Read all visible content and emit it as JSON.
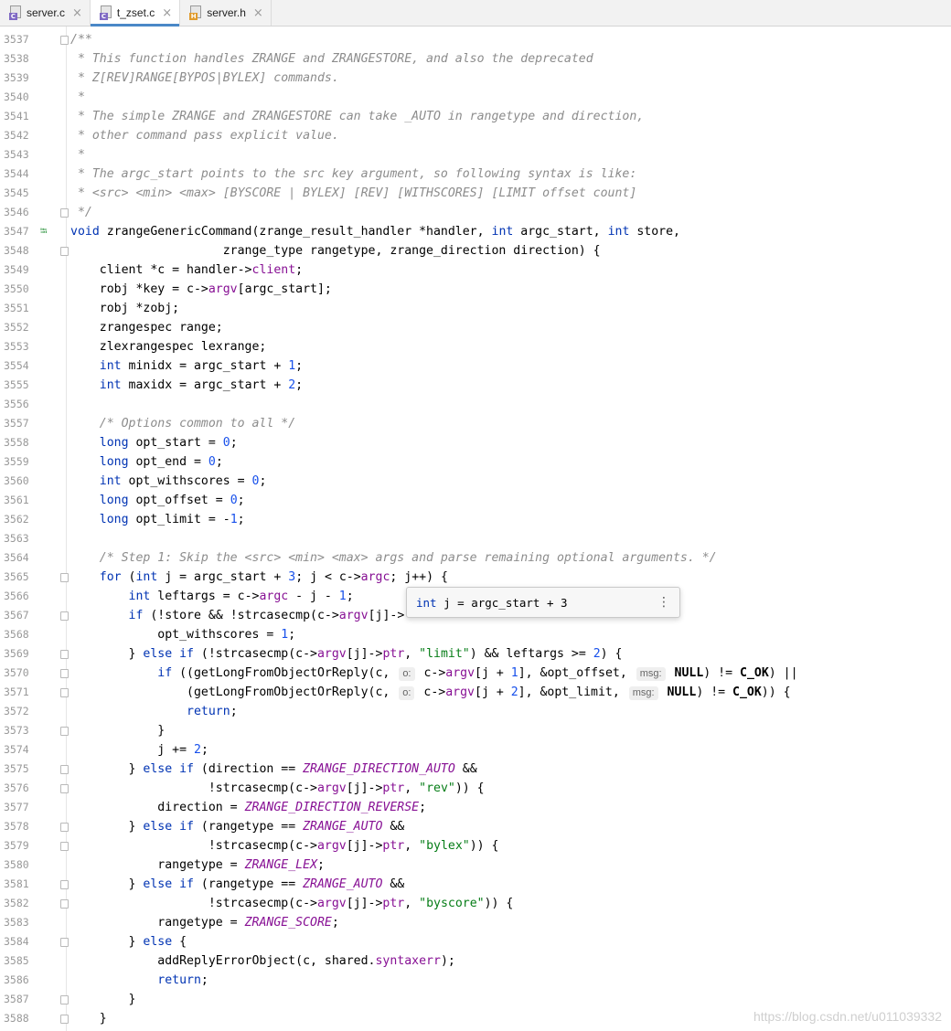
{
  "tabs": [
    {
      "label": "server.c",
      "type": "c",
      "active": false
    },
    {
      "label": "t_zset.c",
      "type": "c",
      "active": true
    },
    {
      "label": "server.h",
      "type": "h",
      "active": false
    }
  ],
  "tab_close_glyph": "×",
  "popup": {
    "keyword": "int",
    "text": " j = argc_start + 3",
    "menu_glyph": "⋮"
  },
  "watermark": "https://blog.csdn.net/u011039332",
  "lines": [
    {
      "n": "3537",
      "fold": true,
      "tokens": [
        [
          "cm",
          "/**"
        ]
      ]
    },
    {
      "n": "3538",
      "tokens": [
        [
          "cm",
          " * This function handles ZRANGE and ZRANGESTORE, and also the deprecated"
        ]
      ]
    },
    {
      "n": "3539",
      "tokens": [
        [
          "cm",
          " * Z[REV]RANGE[BYPOS|BYLEX] commands."
        ]
      ]
    },
    {
      "n": "3540",
      "tokens": [
        [
          "cm",
          " *"
        ]
      ]
    },
    {
      "n": "3541",
      "tokens": [
        [
          "cm",
          " * The simple ZRANGE and ZRANGESTORE can take _AUTO in rangetype and direction,"
        ]
      ]
    },
    {
      "n": "3542",
      "tokens": [
        [
          "cm",
          " * other command pass explicit value."
        ]
      ]
    },
    {
      "n": "3543",
      "tokens": [
        [
          "cm",
          " *"
        ]
      ]
    },
    {
      "n": "3544",
      "tokens": [
        [
          "cm",
          " * The argc_start points to the src key argument, so following syntax is like:"
        ]
      ]
    },
    {
      "n": "3545",
      "tokens": [
        [
          "cm",
          " * <src> <min> <max> [BYSCORE | BYLEX] [REV] [WITHSCORES] [LIMIT offset count]"
        ]
      ]
    },
    {
      "n": "3546",
      "fold": true,
      "tokens": [
        [
          "cm",
          " */"
        ]
      ]
    },
    {
      "n": "3547",
      "marker": "⭾",
      "tokens": [
        [
          "kw",
          "void"
        ],
        [
          "",
          " zrangeGenericCommand(zrange_result_handler *handler, "
        ],
        [
          "kw",
          "int"
        ],
        [
          "",
          " argc_start, "
        ],
        [
          "kw",
          "int"
        ],
        [
          "",
          " store,"
        ]
      ]
    },
    {
      "n": "3548",
      "fold": true,
      "tokens": [
        [
          "",
          "                     zrange_type rangetype, zrange_direction direction) {"
        ]
      ]
    },
    {
      "n": "3549",
      "tokens": [
        [
          "",
          "    client *c = handler->"
        ],
        [
          "fld",
          "client"
        ],
        [
          "",
          ";"
        ]
      ]
    },
    {
      "n": "3550",
      "tokens": [
        [
          "",
          "    robj *key = c->"
        ],
        [
          "fld",
          "argv"
        ],
        [
          "",
          "[argc_start];"
        ]
      ]
    },
    {
      "n": "3551",
      "tokens": [
        [
          "",
          "    robj *zobj;"
        ]
      ]
    },
    {
      "n": "3552",
      "tokens": [
        [
          "",
          "    zrangespec range;"
        ]
      ]
    },
    {
      "n": "3553",
      "tokens": [
        [
          "",
          "    zlexrangespec lexrange;"
        ]
      ]
    },
    {
      "n": "3554",
      "tokens": [
        [
          "",
          "    "
        ],
        [
          "kw",
          "int"
        ],
        [
          "",
          " minidx = argc_start + "
        ],
        [
          "num",
          "1"
        ],
        [
          "",
          ";"
        ]
      ]
    },
    {
      "n": "3555",
      "tokens": [
        [
          "",
          "    "
        ],
        [
          "kw",
          "int"
        ],
        [
          "",
          " maxidx = argc_start + "
        ],
        [
          "num",
          "2"
        ],
        [
          "",
          ";"
        ]
      ]
    },
    {
      "n": "3556",
      "tokens": []
    },
    {
      "n": "3557",
      "tokens": [
        [
          "",
          "    "
        ],
        [
          "cm",
          "/* Options common to all */"
        ]
      ]
    },
    {
      "n": "3558",
      "tokens": [
        [
          "",
          "    "
        ],
        [
          "kw",
          "long"
        ],
        [
          "",
          " opt_start = "
        ],
        [
          "num",
          "0"
        ],
        [
          "",
          ";"
        ]
      ]
    },
    {
      "n": "3559",
      "tokens": [
        [
          "",
          "    "
        ],
        [
          "kw",
          "long"
        ],
        [
          "",
          " opt_end = "
        ],
        [
          "num",
          "0"
        ],
        [
          "",
          ";"
        ]
      ]
    },
    {
      "n": "3560",
      "tokens": [
        [
          "",
          "    "
        ],
        [
          "kw",
          "int"
        ],
        [
          "",
          " opt_withscores = "
        ],
        [
          "num",
          "0"
        ],
        [
          "",
          ";"
        ]
      ]
    },
    {
      "n": "3561",
      "tokens": [
        [
          "",
          "    "
        ],
        [
          "kw",
          "long"
        ],
        [
          "",
          " opt_offset = "
        ],
        [
          "num",
          "0"
        ],
        [
          "",
          ";"
        ]
      ]
    },
    {
      "n": "3562",
      "tokens": [
        [
          "",
          "    "
        ],
        [
          "kw",
          "long"
        ],
        [
          "",
          " opt_limit = -"
        ],
        [
          "num",
          "1"
        ],
        [
          "",
          ";"
        ]
      ]
    },
    {
      "n": "3563",
      "tokens": []
    },
    {
      "n": "3564",
      "tokens": [
        [
          "",
          "    "
        ],
        [
          "cm",
          "/* Step 1: Skip the <src> <min> <max> args and parse remaining optional arguments. */"
        ]
      ]
    },
    {
      "n": "3565",
      "fold": true,
      "tokens": [
        [
          "",
          "    "
        ],
        [
          "kw",
          "for"
        ],
        [
          "",
          " ("
        ],
        [
          "kw",
          "int"
        ],
        [
          "",
          " j = argc_start + "
        ],
        [
          "num",
          "3"
        ],
        [
          "",
          "; j < c->"
        ],
        [
          "fld",
          "argc"
        ],
        [
          "",
          "; j++) {"
        ]
      ]
    },
    {
      "n": "3566",
      "tokens": [
        [
          "",
          "        "
        ],
        [
          "kw",
          "int"
        ],
        [
          "",
          " leftargs = c->"
        ],
        [
          "fld",
          "argc"
        ],
        [
          "",
          " - j - "
        ],
        [
          "num",
          "1"
        ],
        [
          "",
          ";"
        ]
      ]
    },
    {
      "n": "3567",
      "fold": true,
      "tokens": [
        [
          "",
          "        "
        ],
        [
          "kw",
          "if"
        ],
        [
          "",
          " (!store && !strcasecmp(c->"
        ],
        [
          "fld",
          "argv"
        ],
        [
          "",
          "[j]->"
        ]
      ]
    },
    {
      "n": "3568",
      "tokens": [
        [
          "",
          "            opt_withscores = "
        ],
        [
          "num",
          "1"
        ],
        [
          "",
          ";"
        ]
      ]
    },
    {
      "n": "3569",
      "fold": true,
      "tokens": [
        [
          "",
          "        } "
        ],
        [
          "kw",
          "else if"
        ],
        [
          "",
          " (!strcasecmp(c->"
        ],
        [
          "fld",
          "argv"
        ],
        [
          "",
          "[j]->"
        ],
        [
          "fld",
          "ptr"
        ],
        [
          "",
          ", "
        ],
        [
          "str",
          "\"limit\""
        ],
        [
          "",
          ") && leftargs >= "
        ],
        [
          "num",
          "2"
        ],
        [
          "",
          ") {"
        ]
      ]
    },
    {
      "n": "3570",
      "fold": true,
      "tokens": [
        [
          "",
          "            "
        ],
        [
          "kw",
          "if"
        ],
        [
          "",
          " ((getLongFromObjectOrReply(c, "
        ],
        [
          "hint",
          "o:"
        ],
        [
          "",
          " c->"
        ],
        [
          "fld",
          "argv"
        ],
        [
          "",
          "[j + "
        ],
        [
          "num",
          "1"
        ],
        [
          "",
          "], &opt_offset, "
        ],
        [
          "hint",
          "msg:"
        ],
        [
          "",
          " "
        ],
        [
          "bold",
          "NULL"
        ],
        [
          "",
          ") != "
        ],
        [
          "bold",
          "C_OK"
        ],
        [
          "",
          ") ||"
        ]
      ]
    },
    {
      "n": "3571",
      "fold": true,
      "tokens": [
        [
          "",
          "                (getLongFromObjectOrReply(c, "
        ],
        [
          "hint",
          "o:"
        ],
        [
          "",
          " c->"
        ],
        [
          "fld",
          "argv"
        ],
        [
          "",
          "[j + "
        ],
        [
          "num",
          "2"
        ],
        [
          "",
          "], &opt_limit, "
        ],
        [
          "hint",
          "msg:"
        ],
        [
          "",
          " "
        ],
        [
          "bold",
          "NULL"
        ],
        [
          "",
          ") != "
        ],
        [
          "bold",
          "C_OK"
        ],
        [
          "",
          ")) {"
        ]
      ]
    },
    {
      "n": "3572",
      "tokens": [
        [
          "",
          "                "
        ],
        [
          "kw",
          "return"
        ],
        [
          "",
          ";"
        ]
      ]
    },
    {
      "n": "3573",
      "fold": true,
      "tokens": [
        [
          "",
          "            }"
        ]
      ]
    },
    {
      "n": "3574",
      "tokens": [
        [
          "",
          "            j += "
        ],
        [
          "num",
          "2"
        ],
        [
          "",
          ";"
        ]
      ]
    },
    {
      "n": "3575",
      "fold": true,
      "tokens": [
        [
          "",
          "        } "
        ],
        [
          "kw",
          "else if"
        ],
        [
          "",
          " (direction == "
        ],
        [
          "mac",
          "ZRANGE_DIRECTION_AUTO"
        ],
        [
          "",
          " &&"
        ]
      ]
    },
    {
      "n": "3576",
      "fold": true,
      "tokens": [
        [
          "",
          "                   !strcasecmp(c->"
        ],
        [
          "fld",
          "argv"
        ],
        [
          "",
          "[j]->"
        ],
        [
          "fld",
          "ptr"
        ],
        [
          "",
          ", "
        ],
        [
          "str",
          "\"rev\""
        ],
        [
          "",
          ")) {"
        ]
      ]
    },
    {
      "n": "3577",
      "tokens": [
        [
          "",
          "            direction = "
        ],
        [
          "mac",
          "ZRANGE_DIRECTION_REVERSE"
        ],
        [
          "",
          ";"
        ]
      ]
    },
    {
      "n": "3578",
      "fold": true,
      "tokens": [
        [
          "",
          "        } "
        ],
        [
          "kw",
          "else if"
        ],
        [
          "",
          " (rangetype == "
        ],
        [
          "mac",
          "ZRANGE_AUTO"
        ],
        [
          "",
          " &&"
        ]
      ]
    },
    {
      "n": "3579",
      "fold": true,
      "tokens": [
        [
          "",
          "                   !strcasecmp(c->"
        ],
        [
          "fld",
          "argv"
        ],
        [
          "",
          "[j]->"
        ],
        [
          "fld",
          "ptr"
        ],
        [
          "",
          ", "
        ],
        [
          "str",
          "\"bylex\""
        ],
        [
          "",
          ")) {"
        ]
      ]
    },
    {
      "n": "3580",
      "tokens": [
        [
          "",
          "            rangetype = "
        ],
        [
          "mac",
          "ZRANGE_LEX"
        ],
        [
          "",
          ";"
        ]
      ]
    },
    {
      "n": "3581",
      "fold": true,
      "tokens": [
        [
          "",
          "        } "
        ],
        [
          "kw",
          "else if"
        ],
        [
          "",
          " (rangetype == "
        ],
        [
          "mac",
          "ZRANGE_AUTO"
        ],
        [
          "",
          " &&"
        ]
      ]
    },
    {
      "n": "3582",
      "fold": true,
      "tokens": [
        [
          "",
          "                   !strcasecmp(c->"
        ],
        [
          "fld",
          "argv"
        ],
        [
          "",
          "[j]->"
        ],
        [
          "fld",
          "ptr"
        ],
        [
          "",
          ", "
        ],
        [
          "str",
          "\"byscore\""
        ],
        [
          "",
          ")) {"
        ]
      ]
    },
    {
      "n": "3583",
      "tokens": [
        [
          "",
          "            rangetype = "
        ],
        [
          "mac",
          "ZRANGE_SCORE"
        ],
        [
          "",
          ";"
        ]
      ]
    },
    {
      "n": "3584",
      "fold": true,
      "tokens": [
        [
          "",
          "        } "
        ],
        [
          "kw",
          "else"
        ],
        [
          "",
          " {"
        ]
      ]
    },
    {
      "n": "3585",
      "tokens": [
        [
          "",
          "            addReplyErrorObject(c, shared."
        ],
        [
          "fld",
          "syntaxerr"
        ],
        [
          "",
          ");"
        ]
      ]
    },
    {
      "n": "3586",
      "tokens": [
        [
          "",
          "            "
        ],
        [
          "kw",
          "return"
        ],
        [
          "",
          ";"
        ]
      ]
    },
    {
      "n": "3587",
      "fold": true,
      "tokens": [
        [
          "",
          "        }"
        ]
      ]
    },
    {
      "n": "3588",
      "fold": true,
      "tokens": [
        [
          "",
          "    }"
        ]
      ]
    }
  ]
}
